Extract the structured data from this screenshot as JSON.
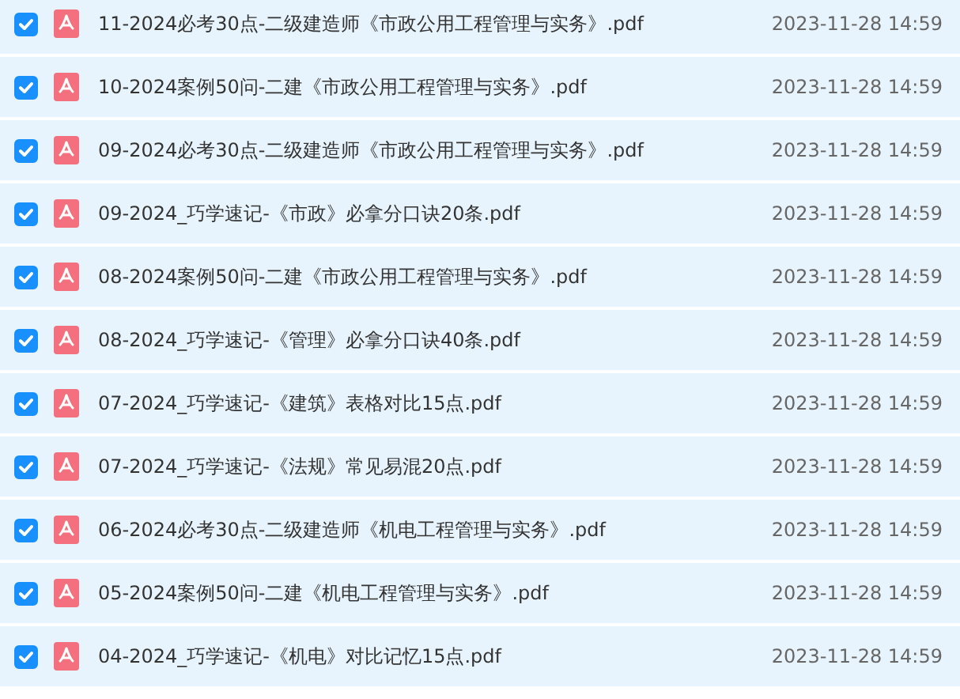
{
  "files": [
    {
      "name": "11-2024必考30点-二级建造师《市政公用工程管理与实务》.pdf",
      "date": "2023-11-28 14:59",
      "checked": true
    },
    {
      "name": "10-2024案例50问-二建《市政公用工程管理与实务》.pdf",
      "date": "2023-11-28 14:59",
      "checked": true
    },
    {
      "name": "09-2024必考30点-二级建造师《市政公用工程管理与实务》.pdf",
      "date": "2023-11-28 14:59",
      "checked": true
    },
    {
      "name": "09-2024_巧学速记-《市政》必拿分口诀20条.pdf",
      "date": "2023-11-28 14:59",
      "checked": true
    },
    {
      "name": "08-2024案例50问-二建《市政公用工程管理与实务》.pdf",
      "date": "2023-11-28 14:59",
      "checked": true
    },
    {
      "name": "08-2024_巧学速记-《管理》必拿分口诀40条.pdf",
      "date": "2023-11-28 14:59",
      "checked": true
    },
    {
      "name": "07-2024_巧学速记-《建筑》表格对比15点.pdf",
      "date": "2023-11-28 14:59",
      "checked": true
    },
    {
      "name": "07-2024_巧学速记-《法规》常见易混20点.pdf",
      "date": "2023-11-28 14:59",
      "checked": true
    },
    {
      "name": "06-2024必考30点-二级建造师《机电工程管理与实务》.pdf",
      "date": "2023-11-28 14:59",
      "checked": true
    },
    {
      "name": "05-2024案例50问-二建《机电工程管理与实务》.pdf",
      "date": "2023-11-28 14:59",
      "checked": true
    },
    {
      "name": "04-2024_巧学速记-《机电》对比记忆15点.pdf",
      "date": "2023-11-28 14:59",
      "checked": true
    }
  ]
}
